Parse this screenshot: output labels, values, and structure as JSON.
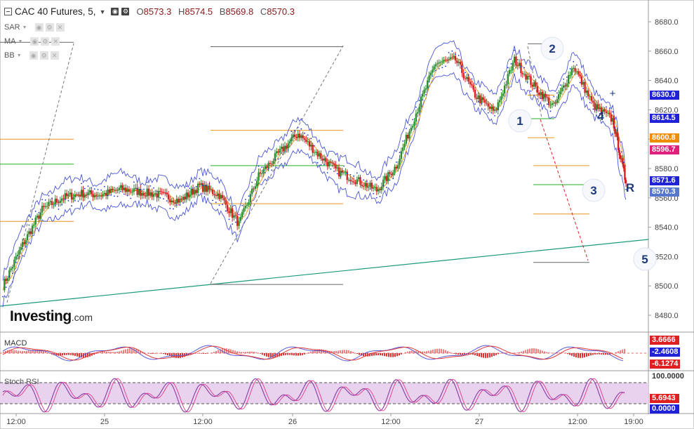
{
  "header": {
    "symbol": "CAC 40 Futures, 5,",
    "open_label": "O",
    "open": "8573.3",
    "high_label": "H",
    "high": "8574.5",
    "low_label": "B",
    "low": "8569.8",
    "close_label": "C",
    "close": "8570.3"
  },
  "indicators": [
    "SAR",
    "MA",
    "BB"
  ],
  "logo": {
    "main": "Investing",
    "suffix": ".com"
  },
  "macd_label": "MACD",
  "rsi_label": "Stoch RSI",
  "colors": {
    "price_up": "#2e8b2e",
    "price_down": "#d62020",
    "bollinger": "#4a55d6",
    "ma": "#f0a030",
    "sar": "#1a2fd8",
    "trendline": "#1a9a7a",
    "fib_orange": "#e8961e",
    "fib_green": "#22b022",
    "fib_gray": "#666666",
    "projection": "#e02020",
    "wave_label": "#1f3a7a",
    "rsi_fill": "#e8d2ee",
    "rsi_line": "#8e44ad"
  },
  "chart_data": {
    "type": "line",
    "title": "CAC 40 Futures, 5,",
    "x_ticks": [
      "12:00",
      "25",
      "12:00",
      "26",
      "12:00",
      "27",
      "12:00",
      "19:00"
    ],
    "y_ticks": [
      8480.0,
      8500.0,
      8520.0,
      8540.0,
      8560.0,
      8580.0,
      8600.0,
      8620.0,
      8640.0,
      8660.0,
      8680.0
    ],
    "ylim": [
      8470,
      8690
    ],
    "series": [
      {
        "name": "",
        "x": [
          0,
          3,
          6,
          9,
          12,
          15,
          18,
          21,
          24,
          27,
          30,
          33,
          36,
          39,
          42,
          45,
          48,
          51,
          54,
          57,
          60,
          63,
          66,
          69,
          72,
          75,
          78,
          81,
          84,
          87,
          90,
          93,
          95
        ],
        "values": [
          8500,
          8528,
          8552,
          8560,
          8563,
          8562,
          8566,
          8564,
          8562,
          8558,
          8568,
          8562,
          8542,
          8575,
          8590,
          8604,
          8590,
          8578,
          8572,
          8565,
          8582,
          8618,
          8652,
          8654,
          8630,
          8618,
          8654,
          8636,
          8622,
          8650,
          8623,
          8613,
          8570
        ]
      }
    ],
    "wave_labels": [
      "1",
      "2",
      "3",
      "4",
      "5",
      "R",
      "+"
    ],
    "price_tags": [
      {
        "value": "8630.0",
        "color": "#1f22d6"
      },
      {
        "value": "8614.5",
        "color": "#1f22d6"
      },
      {
        "value": "8600.8",
        "color": "#f08c00"
      },
      {
        "value": "8596.7",
        "color": "#e0207a"
      },
      {
        "value": "8571.6",
        "color": "#1f22d6"
      },
      {
        "value": "8570.3",
        "color": "#5577cc"
      }
    ],
    "macd": {
      "ylim": [
        -7,
        5
      ],
      "tags": [
        {
          "value": "3.6666",
          "color": "#e02020"
        },
        {
          "value": "-2.4608",
          "color": "#1f22d6"
        },
        {
          "value": "-6.1274",
          "color": "#e02020"
        }
      ]
    },
    "stoch_rsi": {
      "ylim": [
        0,
        100
      ],
      "tags": [
        {
          "value": "100.0000",
          "color": ""
        },
        {
          "value": "5.6943",
          "color": "#e02020"
        },
        {
          "value": "0.0000",
          "color": "#1f22d6"
        }
      ]
    }
  }
}
